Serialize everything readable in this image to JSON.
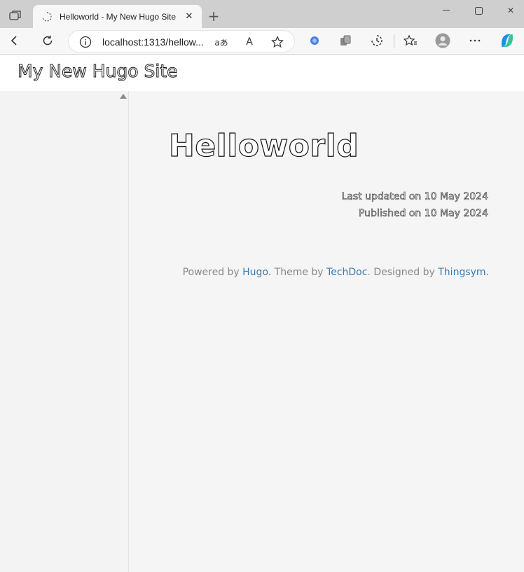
{
  "browser": {
    "tab": {
      "title": "Helloworld - My New Hugo Site",
      "close_icon": "close-icon",
      "favicon": "loading-spinner-icon"
    },
    "new_tab_label": "+",
    "address": {
      "url": "localhost:1313/hellow...",
      "read_aloud_label": "A",
      "translate_label": "aあ"
    }
  },
  "site": {
    "title": "My New Hugo Site"
  },
  "page": {
    "title": "Helloworld",
    "last_updated": "Last updated on 10 May 2024",
    "published": "Published on 10 May 2024"
  },
  "footer": {
    "powered_by": "Powered by ",
    "hugo": "Hugo",
    "theme_by": ". Theme by ",
    "techdoc": "TechDoc",
    "designed_by": ". Designed by ",
    "thingsym": "Thingsym",
    "end": "."
  },
  "colors": {
    "link": "#3a7bb5",
    "chrome_bg": "#cfcfcf",
    "toolbar_bg": "#f7f7f7"
  }
}
